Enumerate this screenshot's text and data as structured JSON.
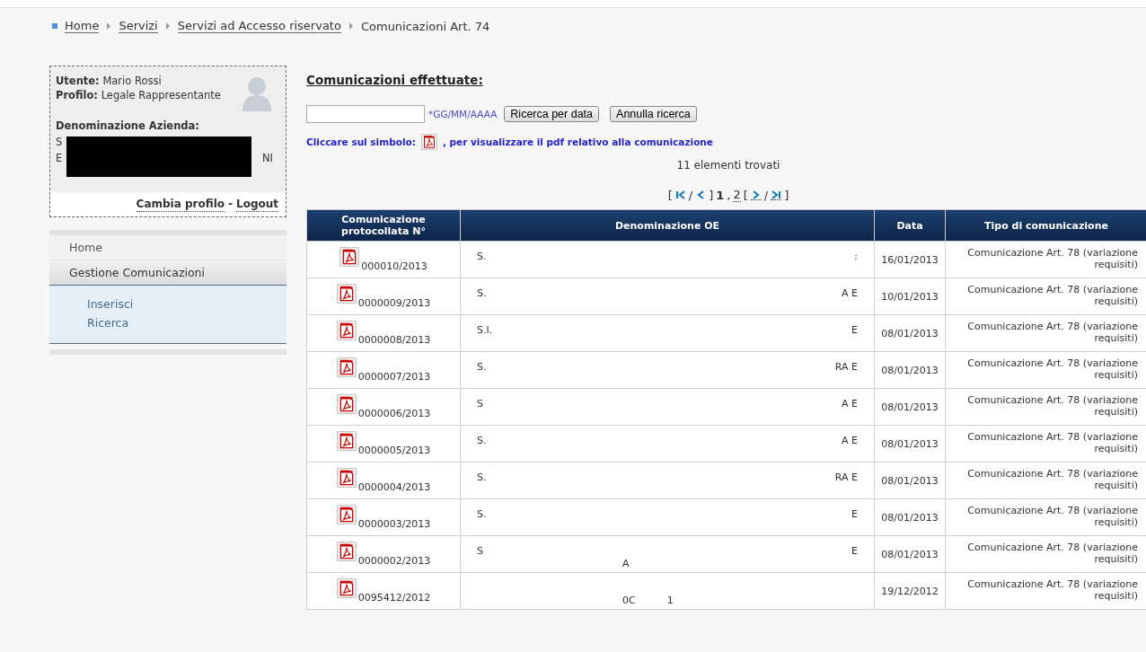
{
  "breadcrumb": [
    {
      "label": "Home",
      "link": true
    },
    {
      "label": "Servizi",
      "link": true
    },
    {
      "label": "Servizi ad Accesso riservato",
      "link": true
    },
    {
      "label": "Comunicazioni Art. 74",
      "link": false
    }
  ],
  "user_box": {
    "user_label": "Utente:",
    "user_name": "Mario Rossi",
    "profile_label": "Profilo:",
    "profile_name": "Legale Rappresentante",
    "company_label": "Denominazione Azienda:",
    "company_fragments": [
      "S",
      "E",
      "NI"
    ],
    "change_profile": "Cambia profilo",
    "separator": "-",
    "logout": "Logout"
  },
  "menu": [
    {
      "label": "Home",
      "expanded": false
    },
    {
      "label": "Gestione Comunicazioni",
      "expanded": true,
      "children": [
        {
          "label": "Inserisci"
        },
        {
          "label": "Ricerca"
        }
      ]
    }
  ],
  "title": "Comunicazioni effettuate:",
  "search": {
    "hint": "*GG/MM/AAAA",
    "buttons": [
      "Ricerca per data",
      "Annulla ricerca"
    ]
  },
  "instruction": {
    "before": "Cliccare sul simbolo:",
    "after": ", per visualizzare il pdf relativo alla comunicazione"
  },
  "count": "11 elementi trovati",
  "pagination": {
    "open": "[",
    "middle": "]",
    "close": "]",
    "open2": "[",
    "sep": "/",
    "pages": [
      {
        "label": "1",
        "selected": true
      },
      {
        "label": "2",
        "selected": false
      }
    ],
    "comma": ","
  },
  "table": {
    "columns": [
      "Comunicazione protocollata N°",
      "Denominazione OE",
      "Data",
      "Tipo di comunicazione"
    ],
    "rows": [
      {
        "number": "000010/2013",
        "name_start": "S.",
        "name_end": ":",
        "date": "16/01/2013",
        "type": "Comunicazione Art. 78 (variazione requisiti)"
      },
      {
        "number": "0000009/2013",
        "name_start": "S.",
        "name_end": "A E",
        "date": "10/01/2013",
        "type": "Comunicazione Art. 78 (variazione requisiti)"
      },
      {
        "number": "0000008/2013",
        "name_start": "S.I.",
        "name_end": "E",
        "date": "08/01/2013",
        "type": "Comunicazione Art. 78 (variazione requisiti)"
      },
      {
        "number": "0000007/2013",
        "name_start": "S.",
        "name_end": "RA E",
        "date": "08/01/2013",
        "type": "Comunicazione Art. 78 (variazione requisiti)"
      },
      {
        "number": "0000006/2013",
        "name_start": "S",
        "name_end": "A E",
        "date": "08/01/2013",
        "type": "Comunicazione Art. 78 (variazione requisiti)"
      },
      {
        "number": "0000005/2013",
        "name_start": "S.",
        "name_end": "A E",
        "date": "08/01/2013",
        "type": "Comunicazione Art. 78 (variazione requisiti)"
      },
      {
        "number": "0000004/2013",
        "name_start": "S.",
        "name_end": "RA E",
        "date": "08/01/2013",
        "type": "Comunicazione Art. 78 (variazione requisiti)"
      },
      {
        "number": "0000003/2013",
        "name_start": "S.",
        "name_end": "E",
        "date": "08/01/2013",
        "type": "Comunicazione Art. 78 (variazione requisiti)"
      },
      {
        "number": "0000002/2013",
        "name_start": "S",
        "name_end": "E",
        "name_line2": "A",
        "date": "08/01/2013",
        "type": "Comunicazione Art. 78 (variazione requisiti)"
      },
      {
        "number": "0095412/2012",
        "name_line2": "0C          1",
        "date": "19/12/2012",
        "type": "Comunicazione Art. 78 (variazione requisiti)"
      }
    ]
  }
}
